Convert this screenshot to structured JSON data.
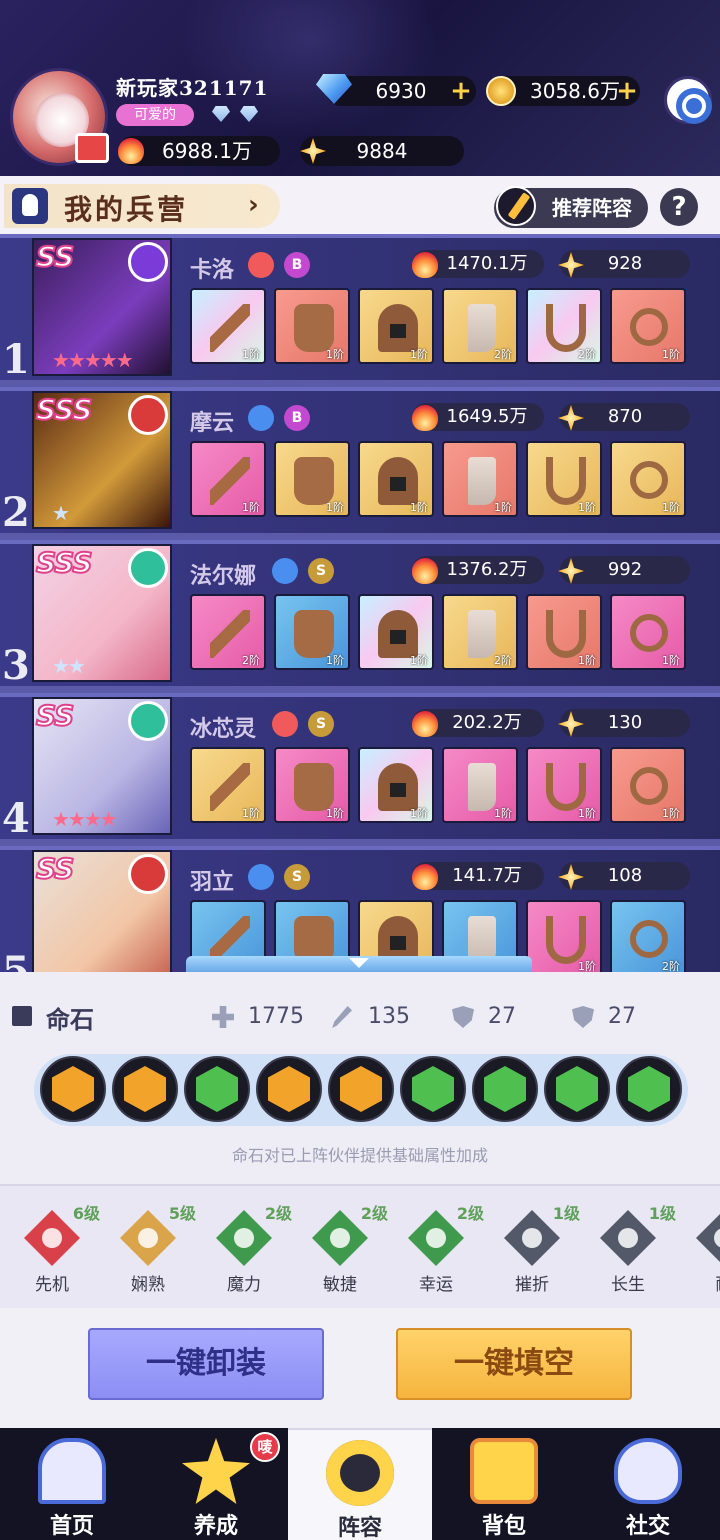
{
  "player": {
    "name": "新玩家321171",
    "title_tag": "可爱的",
    "diamonds": "6930",
    "gold": "3058.6万",
    "power": "6988.1万",
    "stars": "9884"
  },
  "section": {
    "title": "我的兵营",
    "recommend_label": "推荐阵容",
    "help_label": "?"
  },
  "heroes": [
    {
      "index": "1",
      "rank": "SS",
      "name": "卡洛",
      "grade": "B",
      "power": "1470.1万",
      "score": "928",
      "star_count": 5,
      "element_color": "#7a3bd9",
      "class_color": "#f05a5a",
      "equipment": [
        {
          "type": "sword",
          "bg": "holo",
          "level": "1阶"
        },
        {
          "type": "armor",
          "bg": "salmon",
          "level": "1阶"
        },
        {
          "type": "helm",
          "bg": "gold",
          "level": "1阶"
        },
        {
          "type": "boot",
          "bg": "gold",
          "level": "2阶"
        },
        {
          "type": "amulet",
          "bg": "holo",
          "level": "2阶"
        },
        {
          "type": "ring",
          "bg": "salmon",
          "level": "1阶"
        }
      ]
    },
    {
      "index": "2",
      "rank": "SSS",
      "name": "摩云",
      "grade": "B",
      "power": "1649.5万",
      "score": "870",
      "star_count": 1,
      "element_color": "#d93b3b",
      "class_color": "#4a8ff0",
      "equipment": [
        {
          "type": "sword",
          "bg": "pink",
          "level": "1阶"
        },
        {
          "type": "armor",
          "bg": "gold",
          "level": "1阶"
        },
        {
          "type": "helm",
          "bg": "gold",
          "level": "1阶"
        },
        {
          "type": "boot",
          "bg": "salmon",
          "level": "1阶"
        },
        {
          "type": "amulet",
          "bg": "gold",
          "level": "1阶"
        },
        {
          "type": "ring",
          "bg": "gold",
          "level": "1阶"
        }
      ]
    },
    {
      "index": "3",
      "rank": "SSS",
      "name": "法尔娜",
      "grade": "S",
      "power": "1376.2万",
      "score": "992",
      "star_count": 2,
      "element_color": "#2fbf9a",
      "class_color": "#4a8ff0",
      "equipment": [
        {
          "type": "sword",
          "bg": "pink",
          "level": "2阶"
        },
        {
          "type": "armor",
          "bg": "blue",
          "level": "1阶"
        },
        {
          "type": "helm",
          "bg": "holo",
          "level": "1阶"
        },
        {
          "type": "boot",
          "bg": "gold",
          "level": "2阶"
        },
        {
          "type": "amulet",
          "bg": "salmon",
          "level": "1阶"
        },
        {
          "type": "ring",
          "bg": "pink",
          "level": "1阶"
        }
      ]
    },
    {
      "index": "4",
      "rank": "SS",
      "name": "冰芯灵",
      "grade": "S",
      "power": "202.2万",
      "score": "130",
      "star_count": 4,
      "element_color": "#2fbf9a",
      "class_color": "#f05a5a",
      "equipment": [
        {
          "type": "sword",
          "bg": "gold",
          "level": "1阶"
        },
        {
          "type": "armor",
          "bg": "pink",
          "level": "1阶"
        },
        {
          "type": "helm",
          "bg": "holo",
          "level": "1阶"
        },
        {
          "type": "boot",
          "bg": "pink",
          "level": "1阶"
        },
        {
          "type": "amulet",
          "bg": "pink",
          "level": "1阶"
        },
        {
          "type": "ring",
          "bg": "salmon",
          "level": "1阶"
        }
      ]
    },
    {
      "index": "5",
      "rank": "SS",
      "name": "羽立",
      "grade": "S",
      "power": "141.7万",
      "score": "108",
      "star_count": 0,
      "element_color": "#d93b3b",
      "class_color": "#4a8ff0",
      "equipment": [
        {
          "type": "sword",
          "bg": "blue",
          "level": ""
        },
        {
          "type": "armor",
          "bg": "blue",
          "level": ""
        },
        {
          "type": "helm",
          "bg": "gold",
          "level": ""
        },
        {
          "type": "boot",
          "bg": "blue",
          "level": ""
        },
        {
          "type": "amulet",
          "bg": "pink",
          "level": "1阶"
        },
        {
          "type": "ring",
          "bg": "blue",
          "level": "2阶"
        }
      ]
    }
  ],
  "fate_stone": {
    "title": "命石",
    "hp": "1775",
    "attack": "135",
    "defense": "27",
    "magic_defense": "27",
    "note": "命石对已上阵伙伴提供基础属性加成",
    "gems": [
      "#f1a32a",
      "#f1a32a",
      "#4fc04f",
      "#f1a32a",
      "#f1a32a",
      "#4fc04f",
      "#4fc04f",
      "#4fc04f",
      "#4fc04f"
    ]
  },
  "skills": [
    {
      "name": "先机",
      "level": "6级",
      "color": "#d9414a"
    },
    {
      "name": "娴熟",
      "level": "5级",
      "color": "#d9a44a"
    },
    {
      "name": "魔力",
      "level": "2级",
      "color": "#3f9a4e"
    },
    {
      "name": "敏捷",
      "level": "2级",
      "color": "#3f9a4e"
    },
    {
      "name": "幸运",
      "level": "2级",
      "color": "#3f9a4e"
    },
    {
      "name": "摧折",
      "level": "1级",
      "color": "#54596a"
    },
    {
      "name": "长生",
      "level": "1级",
      "color": "#54596a"
    },
    {
      "name": "耐",
      "level": "",
      "color": "#54596a"
    }
  ],
  "actions": {
    "unequip_all": "一键卸装",
    "fill_all": "一键填空"
  },
  "nav": {
    "items": [
      {
        "label": "首页",
        "color": "#e8e8ff"
      },
      {
        "label": "养成",
        "color": "#ffd44a"
      },
      {
        "label": "阵容",
        "color": "#ffd44a"
      },
      {
        "label": "背包",
        "color": "#ffd44a"
      },
      {
        "label": "社交",
        "color": "#e8e8ff"
      }
    ],
    "badge": "唛"
  }
}
